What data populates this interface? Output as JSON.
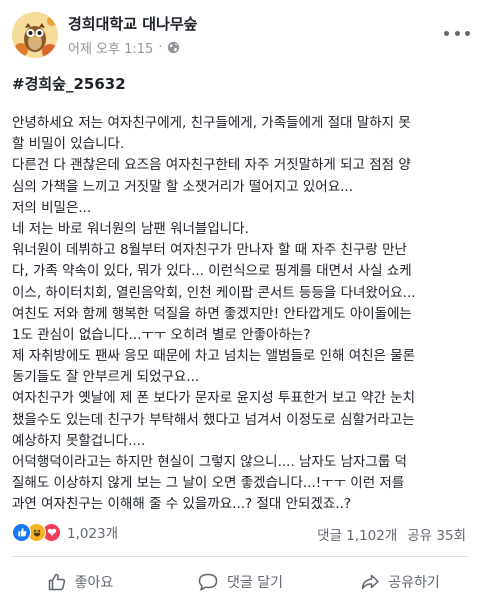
{
  "header": {
    "page_name": "경희대학교 대나무숲",
    "timestamp": "어제 오후 1:15",
    "separator": "·",
    "privacy_icon": "globe-icon",
    "more_icon": "more-dots-icon"
  },
  "post": {
    "hashtag": "#경희숲_25632",
    "lines": [
      "안녕하세요 저는 여자친구에게, 친구들에게, 가족들에게 절대 말하지 못",
      "할 비밀이 있습니다.",
      "다른건 다 괜찮은데 요즈음 여자친구한테 자주 거짓말하게 되고 점점 양",
      "심의 가책을 느끼고 거짓말 할 소잿거리가 떨어지고 있어요...",
      "저의 비밀은...",
      "네 저는 바로 워너원의 남팬 워너블입니다.",
      "워너원이 데뷔하고 8월부터 여자친구가 만나자 할 때 자주 친구랑 만난",
      "다, 가족 약속이 있다, 뭐가 있다... 이런식으로 핑계를 대면서 사실 쇼케",
      "이스, 하이터치회, 열린음악회, 인천 케이팝 콘서트 등등을 다녀왔어요...",
      "여친도 저와 함께 행복한 덕질을 하면 좋겠지만! 안타깝게도 아이돌에는",
      "1도 관심이 없습니다...ㅜㅜ 오히려 별로 안좋아하는?",
      "제 자취방에도 팬싸 응모 때문에 차고 넘치는 앨범들로 인해 여친은 물론",
      "동기들도 잘 안부르게 되었구요...",
      "여자친구가 옛날에 제 폰 보다가 문자로 윤지성 투표한거 보고 약간 눈치",
      "챘을수도 있는데 친구가 부탁해서 했다고 넘겨서 이정도로 심할거라고는",
      "예상하지 못할겁니다....",
      "어덕행덕이라고는 하지만 현실이 그렇지 않으니.... 남자도 남자그룹 덕",
      "질해도 이상하지 않게 보는 그 날이 오면 좋겠습니다...!ㅜㅜ 이런 저를",
      "과연 여자친구는 이해해 줄 수 있을까요...? 절대 안되겠죠..?"
    ]
  },
  "stats": {
    "reaction_icons": [
      "like-icon",
      "haha-icon",
      "love-icon"
    ],
    "reaction_count": "1,023개",
    "comments": "댓글 1,102개",
    "shares": "공유 35회"
  },
  "actions": {
    "like": "좋아요",
    "comment": "댓글 달기",
    "share": "공유하기"
  },
  "colors": {
    "facebook_blue": "#1877f2",
    "haha_yellow": "#f7b125",
    "love_red": "#f33e58",
    "muted_text": "#606770"
  }
}
